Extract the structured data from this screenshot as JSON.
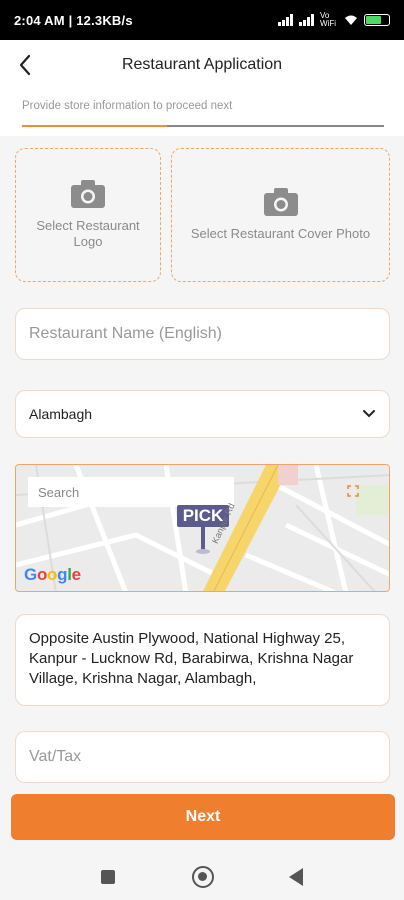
{
  "status_bar": {
    "time_network": "2:04 AM | 12.3KB/s",
    "volte": "Vo WiFi",
    "battery_level": 0.7
  },
  "header": {
    "title": "Restaurant Application",
    "back_icon": "back-arrow-icon"
  },
  "progress": {
    "text": "Provide store information to proceed next",
    "fraction": 0.4,
    "accent": "#f08a3c"
  },
  "uploads": {
    "logo_label": "Select Restaurant Logo",
    "cover_label": "Select Restaurant Cover Photo",
    "icon": "camera-icon"
  },
  "form": {
    "name_placeholder": "Restaurant Name (English)",
    "city_value": "Alambagh",
    "address_value": "Opposite Austin Plywood, National Highway 25, Kanpur - Lucknow Rd, Barabirwa, Krishna Nagar Village, Krishna Nagar, Alambagh,",
    "vat_placeholder": "Vat/Tax"
  },
  "map": {
    "search_placeholder": "Search",
    "pin_label": "PICK",
    "road_label": "Kanpur Rd",
    "brand": "Google"
  },
  "actions": {
    "next_label": "Next",
    "button_color": "#ef7e2f"
  }
}
